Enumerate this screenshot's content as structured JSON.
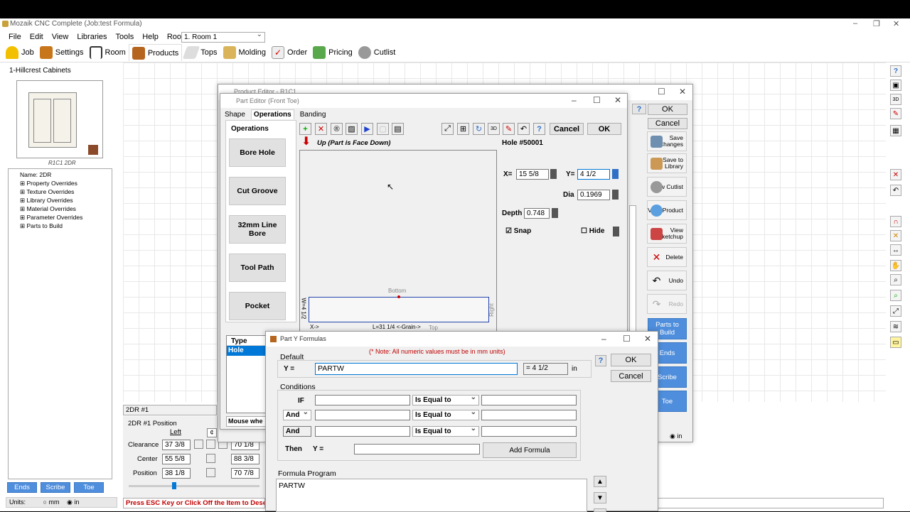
{
  "app": {
    "title": "Mozaik CNC Complete (Job:test Formula)"
  },
  "menu": [
    "File",
    "Edit",
    "View",
    "Libraries",
    "Tools",
    "Help"
  ],
  "room": {
    "label": "Room:",
    "value": "1. Room 1"
  },
  "toolbar": [
    "Job",
    "Settings",
    "Room",
    "Products",
    "Tops",
    "Molding",
    "Order",
    "Pricing",
    "Cutlist"
  ],
  "left": {
    "job_title": "1-Hillcrest Cabinets",
    "thumb_caption": "R1C1 2DR",
    "tree": [
      "Name: 2DR",
      "Property Overrides",
      "Texture Overrides",
      "Library Overrides",
      "Material Overrides",
      "Parameter Overrides",
      "Parts to Build"
    ],
    "tabs": [
      "Ends",
      "Scribe",
      "Toe"
    ],
    "units_label": "Units:",
    "units": [
      "mm",
      "in"
    ]
  },
  "position": {
    "selector": "2DR #1",
    "title": "2DR #1 Position",
    "col_left": "Left",
    "rows": [
      {
        "label": "Clearance",
        "left": "37 3/8",
        "right": "70 1/8"
      },
      {
        "label": "Center",
        "left": "55 5/8",
        "right": "88 3/8"
      },
      {
        "label": "Position",
        "left": "38 1/8",
        "right": "70 7/8"
      }
    ]
  },
  "status": {
    "message": "Press ESC Key or Click Off the Item to Dese"
  },
  "product_editor": {
    "title": "Product Editor - R1C1",
    "ok": "OK",
    "cancel": "Cancel",
    "help": "?",
    "buttons": [
      "Save Changes",
      "Save to Library",
      "View Cutlist",
      "View Product",
      "View Sketchup",
      "Delete",
      "Undo",
      "Redo"
    ],
    "blue_buttons": [
      "Parts to Build",
      "Ends",
      "Scribe",
      "Toe"
    ],
    "units": "in"
  },
  "part_editor": {
    "title": "Part Editor (Front Toe)",
    "tabs": [
      "Shape",
      "Operations",
      "Banding"
    ],
    "ops_title": "Operations",
    "ops": [
      "Bore Hole",
      "Cut Groove",
      "32mm Line Bore",
      "Tool Path",
      "Pocket"
    ],
    "cancel": "Cancel",
    "ok": "OK",
    "up_label": "Up (Part is Face Down)",
    "hole": "Hole #50001",
    "x_label": "X=",
    "x": "15 5/8",
    "y_label": "Y=",
    "y": "4 1/2",
    "dia_label": "Dia",
    "dia": "0.1969",
    "depth_label": "Depth",
    "depth": "0.748",
    "snap": "Snap",
    "hide": "Hide",
    "canvas": {
      "bottom": "Bottom",
      "top": "Top",
      "right": "Right",
      "left_label": "W=4 1/2",
      "xarrow": "X->",
      "length": "L=31 1/4 <-Grain->"
    },
    "type_header": "Type",
    "type_row": "Hole",
    "mouse": "Mouse whe"
  },
  "formula": {
    "title": "Part Y Formulas",
    "note": "(* Note: All numeric values must be in mm units)",
    "default_label": "Default",
    "y_label": "Y =",
    "y_value": "PARTW",
    "result": "= 4 1/2",
    "unit": "in",
    "ok": "OK",
    "cancel": "Cancel",
    "help": "?",
    "conditions_label": "Conditions",
    "if": "IF",
    "and1": "And",
    "and2": "And",
    "cmp": "Is Equal to",
    "then": "Then",
    "then_y": "Y =",
    "add": "Add Formula",
    "program_label": "Formula Program",
    "program": "PARTW"
  },
  "colors": {
    "blue": "#4f8edc",
    "red": "#c00000",
    "accent": "#0078d7"
  }
}
